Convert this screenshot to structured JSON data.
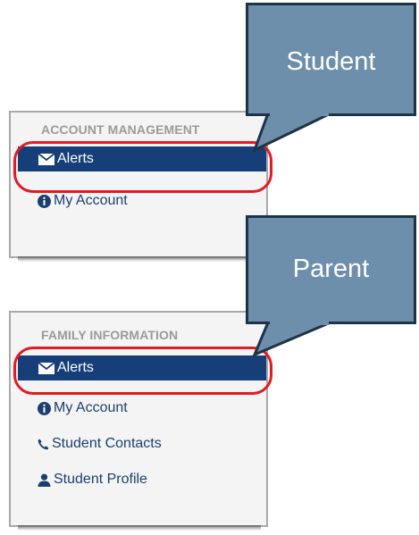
{
  "student_panel": {
    "section_title": "ACCOUNT MANAGEMENT",
    "items": [
      {
        "label": "Alerts",
        "icon": "envelope-icon",
        "active": true
      },
      {
        "label": "My Account",
        "icon": "info-circle-icon",
        "active": false
      }
    ]
  },
  "parent_panel": {
    "section_title": "FAMILY INFORMATION",
    "items": [
      {
        "label": "Alerts",
        "icon": "envelope-icon",
        "active": true
      },
      {
        "label": "My Account",
        "icon": "info-circle-icon",
        "active": false
      },
      {
        "label": "Student Contacts",
        "icon": "phone-icon",
        "active": false
      },
      {
        "label": "Student Profile",
        "icon": "user-icon",
        "active": false
      }
    ]
  },
  "callouts": {
    "student": "Student",
    "parent": "Parent"
  },
  "colors": {
    "active_item_bg": "#163f79",
    "link_text": "#1a3f6f",
    "section_title": "#9a9a9a",
    "highlight_ring": "#e01b24",
    "callout_fill": "#6e8fab",
    "callout_border": "#1f3347"
  }
}
